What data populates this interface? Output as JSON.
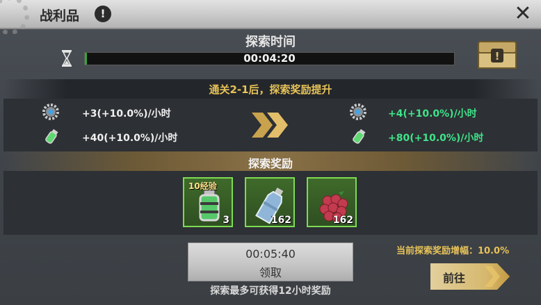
{
  "header": {
    "title": "战利品",
    "info_icon": "info-icon",
    "close_icon": "close-icon"
  },
  "timer": {
    "title": "探索时间",
    "time": "00:04:20",
    "progress": 0.005,
    "hourglass_icon": "hourglass-icon",
    "chest_icon": "chest-info-icon"
  },
  "bonus": {
    "title": "通关2-1后，探索奖励提升",
    "current": [
      {
        "icon": "gear-token-icon",
        "text": "+3(+10.0%)/小时"
      },
      {
        "icon": "exp-vial-icon",
        "text": "+40(+10.0%)/小时"
      }
    ],
    "upgraded": [
      {
        "icon": "gear-token-icon",
        "text": "+4(+10.0%)/小时"
      },
      {
        "icon": "exp-vial-icon",
        "text": "+80(+10.0%)/小时"
      }
    ],
    "arrow_icon": "double-chevron-right-icon",
    "colors": {
      "current": "#f0f0f0",
      "upgraded": "#3fe38a",
      "title": "#e6c258"
    }
  },
  "rewards": {
    "title": "探索奖励",
    "items": [
      {
        "icon": "exp-vial-icon",
        "tag": "10经验",
        "count": "3"
      },
      {
        "icon": "water-bottle-icon",
        "tag": "",
        "count": "162"
      },
      {
        "icon": "raspberry-icon",
        "tag": "",
        "count": "162"
      }
    ]
  },
  "collect": {
    "time": "00:05:40",
    "label": "领取"
  },
  "note": "探索最多可获得12小时奖励",
  "boost": "当前探索奖励增幅：10.0%",
  "go": {
    "label": "前往"
  }
}
